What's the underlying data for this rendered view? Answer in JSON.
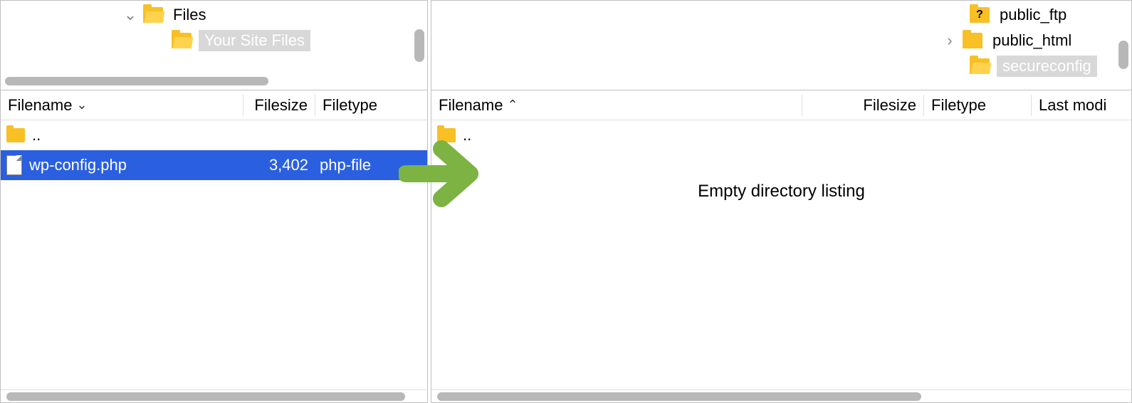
{
  "left": {
    "tree": {
      "items": [
        {
          "label": "Files",
          "selected": false,
          "expander": "down"
        },
        {
          "label": "Your Site Files",
          "selected": true,
          "expander": ""
        }
      ]
    },
    "headers": {
      "filename": "Filename",
      "filesize": "Filesize",
      "filetype": "Filetype",
      "sort": "desc"
    },
    "rows": [
      {
        "name": "..",
        "size": "",
        "type": "",
        "kind": "up"
      },
      {
        "name": "wp-config.php",
        "size": "3,402",
        "type": "php-file",
        "kind": "file",
        "selected": true
      }
    ]
  },
  "right": {
    "tree": {
      "items": [
        {
          "label": "public_ftp",
          "selected": false,
          "icon": "question",
          "expander": ""
        },
        {
          "label": "public_html",
          "selected": false,
          "icon": "folder",
          "expander": "right"
        },
        {
          "label": "secureconfig",
          "selected": true,
          "icon": "open",
          "expander": ""
        }
      ]
    },
    "headers": {
      "filename": "Filename",
      "filesize": "Filesize",
      "filetype": "Filetype",
      "lastmod": "Last modi",
      "sort": "asc"
    },
    "rows": [
      {
        "name": "..",
        "kind": "up"
      }
    ],
    "empty_msg": "Empty directory listing"
  }
}
